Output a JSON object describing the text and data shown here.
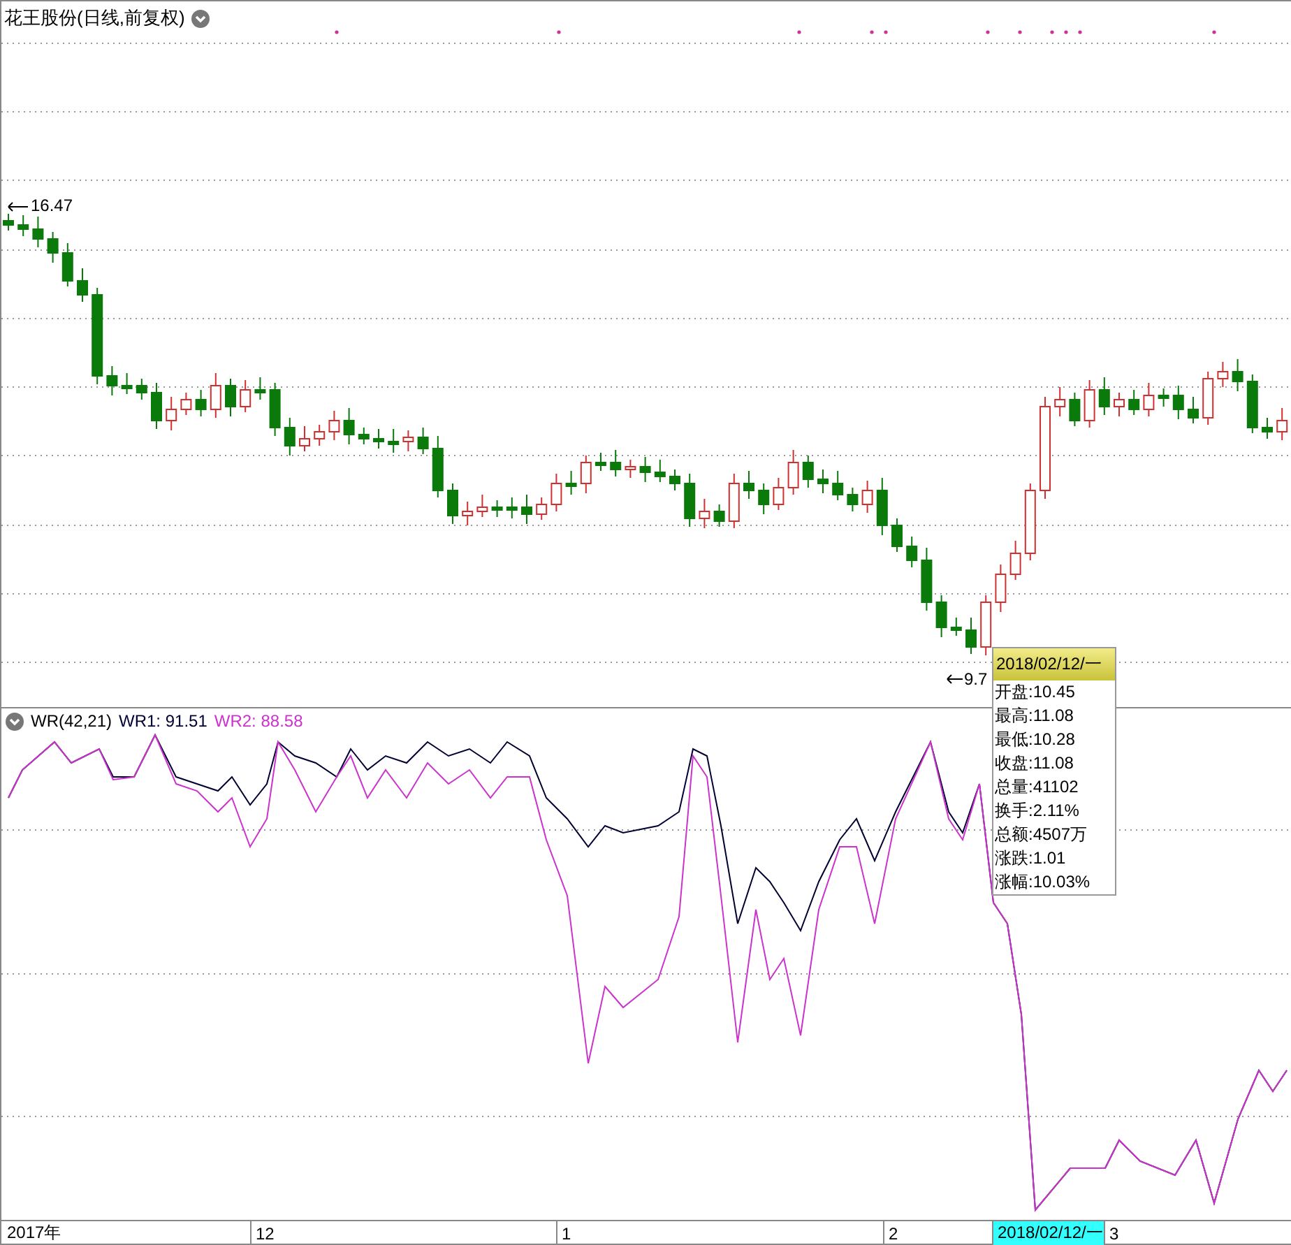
{
  "price_panel": {
    "title": "花王股份(日线,前复权)",
    "high_label": "16.47",
    "low_label": "9.7"
  },
  "indicator_panel": {
    "name": "WR(42,21)",
    "series": [
      {
        "label": "WR1: 91.51",
        "color": "#000033"
      },
      {
        "label": "WR2: 88.58",
        "color": "#cc33cc"
      }
    ]
  },
  "tooltip": {
    "date": "2018/02/12/一",
    "rows": [
      "开盘:10.45",
      "最高:11.08",
      "最低:10.28",
      "收盘:11.08",
      "总量:41102",
      "换手:2.11%",
      "总额:4507万",
      "涨跌:1.01",
      "涨幅:10.03%"
    ]
  },
  "time_axis": {
    "labels": [
      {
        "text": "2017年",
        "selected": false
      },
      {
        "text": "12",
        "selected": false
      },
      {
        "text": "1",
        "selected": false
      },
      {
        "text": "2",
        "selected": false
      },
      {
        "text": "2018/02/12/一",
        "selected": true
      },
      {
        "text": "3",
        "selected": false
      }
    ]
  }
}
